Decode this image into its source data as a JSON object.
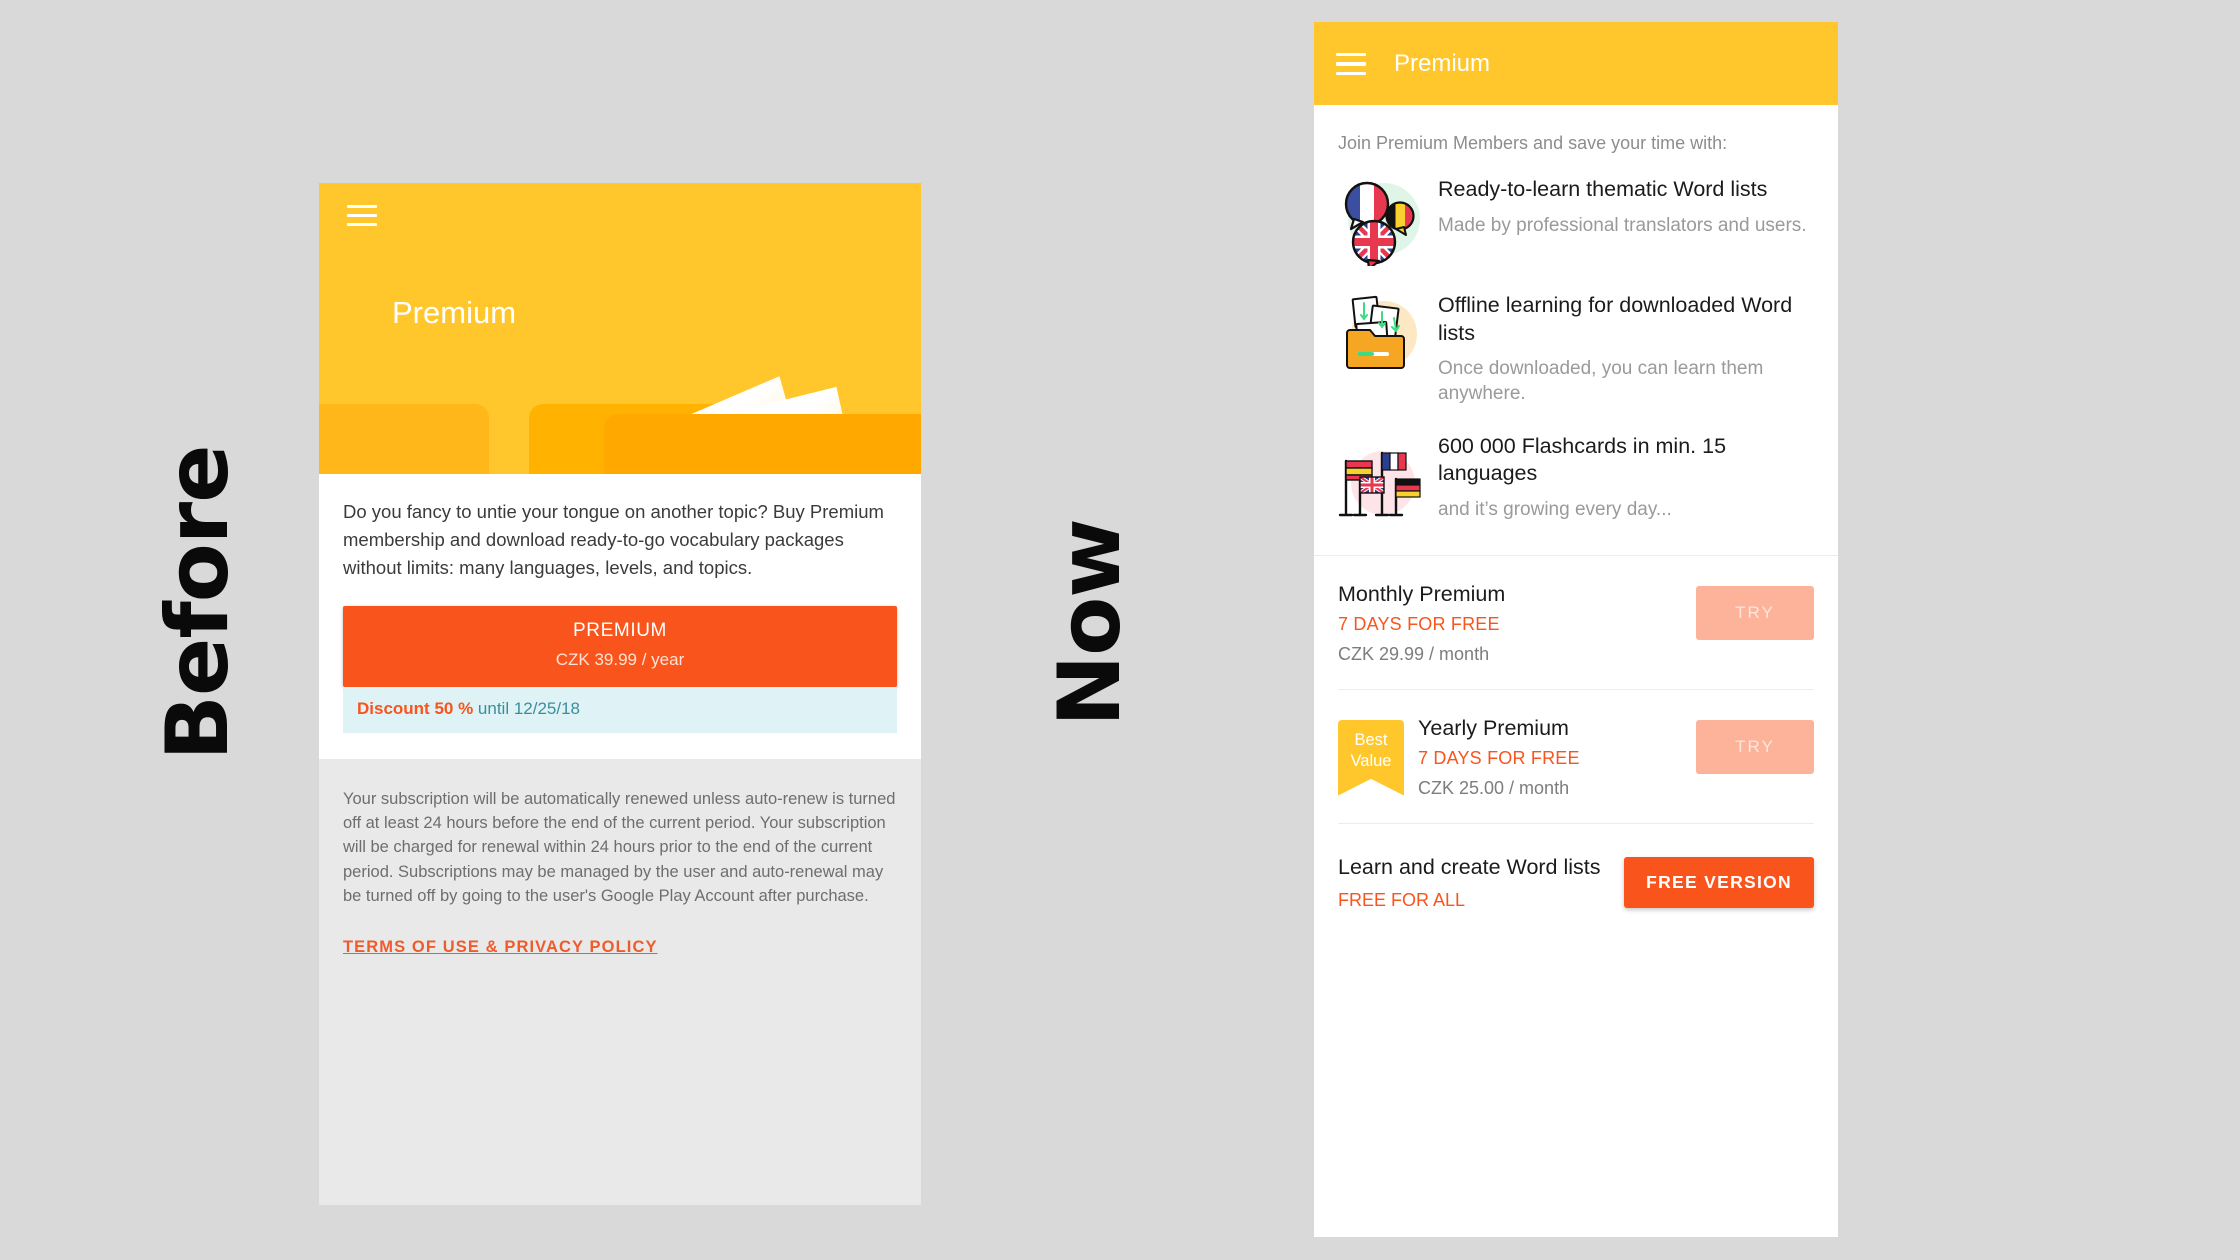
{
  "labels": {
    "before": "Before",
    "now": "Now"
  },
  "before": {
    "hero": {
      "menu_icon": "hamburger-menu-icon",
      "title": "Premium"
    },
    "description": "Do you fancy to untie your tongue on another topic? Buy Premium membership and download ready-to-go vocabulary packages without limits: many languages, levels, and topics.",
    "premium_button": {
      "label": "PREMIUM",
      "price": "CZK 39.99 / year"
    },
    "discount": {
      "strong": "Discount 50 %",
      "rest": " until 12/25/18"
    },
    "legal": "Your subscription will be automatically renewed unless auto-renew is turned off at least 24 hours before the end of the current period. Your subscription will be charged for renewal within 24 hours prior to the end of the current period. Subscriptions may be managed by the user and auto-renewal may be turned off by going to the user's Google Play Account after purchase.",
    "terms_link": "TERMS OF USE & PRIVACY POLICY"
  },
  "now": {
    "appbar": {
      "menu_icon": "hamburger-menu-icon",
      "title": "Premium"
    },
    "intro": "Join Premium Members and save your time with:",
    "features": [
      {
        "icon": "speech-bubbles-flags-icon",
        "title": "Ready-to-learn thematic Word lists",
        "subtitle": "Made by professional translators and users."
      },
      {
        "icon": "folder-download-icon",
        "title": "Offline learning for downloaded Word lists",
        "subtitle": "Once downloaded, you can learn them anywhere."
      },
      {
        "icon": "flag-poles-icon",
        "title": "600 000 Flashcards in min. 15 languages",
        "subtitle": "and it’s growing every day..."
      }
    ],
    "plans": [
      {
        "name": "Monthly Premium",
        "trial": "7 DAYS FOR FREE",
        "price": "CZK 29.99 / month",
        "button": "TRY",
        "badge": null
      },
      {
        "name": "Yearly Premium",
        "trial": "7 DAYS FOR FREE",
        "price": "CZK 25.00 / month",
        "button": "TRY",
        "badge": {
          "line1": "Best",
          "line2": "Value"
        }
      }
    ],
    "free": {
      "title": "Learn and create Word lists",
      "subtitle": "FREE FOR ALL",
      "button": "FREE VERSION"
    }
  },
  "colors": {
    "page_bg": "#d9d9d9",
    "header_yellow": "#ffc72c",
    "accent_orange": "#f9541c",
    "try_pink": "#fcb39a",
    "discount_bg": "#dff2f5",
    "discount_teal": "#3a8f9e",
    "muted_gray": "#9a9a9a"
  }
}
